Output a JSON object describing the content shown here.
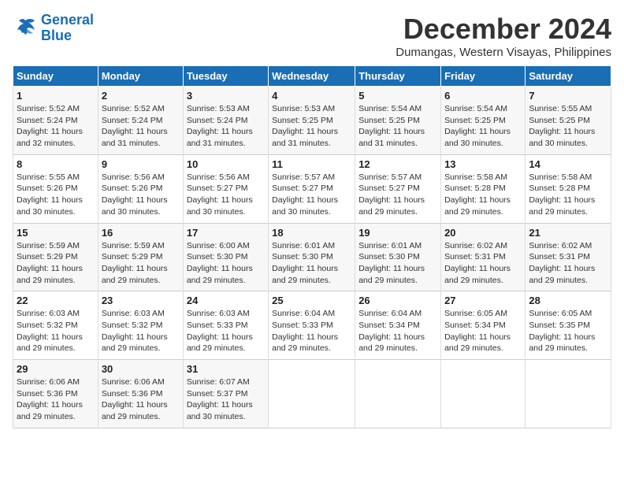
{
  "logo": {
    "line1": "General",
    "line2": "Blue"
  },
  "title": "December 2024",
  "location": "Dumangas, Western Visayas, Philippines",
  "header": {
    "days": [
      "Sunday",
      "Monday",
      "Tuesday",
      "Wednesday",
      "Thursday",
      "Friday",
      "Saturday"
    ]
  },
  "weeks": [
    [
      {
        "day": "1",
        "rise": "5:52 AM",
        "set": "5:24 PM",
        "daylight": "11 hours and 32 minutes."
      },
      {
        "day": "2",
        "rise": "5:52 AM",
        "set": "5:24 PM",
        "daylight": "11 hours and 31 minutes."
      },
      {
        "day": "3",
        "rise": "5:53 AM",
        "set": "5:24 PM",
        "daylight": "11 hours and 31 minutes."
      },
      {
        "day": "4",
        "rise": "5:53 AM",
        "set": "5:25 PM",
        "daylight": "11 hours and 31 minutes."
      },
      {
        "day": "5",
        "rise": "5:54 AM",
        "set": "5:25 PM",
        "daylight": "11 hours and 31 minutes."
      },
      {
        "day": "6",
        "rise": "5:54 AM",
        "set": "5:25 PM",
        "daylight": "11 hours and 30 minutes."
      },
      {
        "day": "7",
        "rise": "5:55 AM",
        "set": "5:25 PM",
        "daylight": "11 hours and 30 minutes."
      }
    ],
    [
      {
        "day": "8",
        "rise": "5:55 AM",
        "set": "5:26 PM",
        "daylight": "11 hours and 30 minutes."
      },
      {
        "day": "9",
        "rise": "5:56 AM",
        "set": "5:26 PM",
        "daylight": "11 hours and 30 minutes."
      },
      {
        "day": "10",
        "rise": "5:56 AM",
        "set": "5:27 PM",
        "daylight": "11 hours and 30 minutes."
      },
      {
        "day": "11",
        "rise": "5:57 AM",
        "set": "5:27 PM",
        "daylight": "11 hours and 30 minutes."
      },
      {
        "day": "12",
        "rise": "5:57 AM",
        "set": "5:27 PM",
        "daylight": "11 hours and 29 minutes."
      },
      {
        "day": "13",
        "rise": "5:58 AM",
        "set": "5:28 PM",
        "daylight": "11 hours and 29 minutes."
      },
      {
        "day": "14",
        "rise": "5:58 AM",
        "set": "5:28 PM",
        "daylight": "11 hours and 29 minutes."
      }
    ],
    [
      {
        "day": "15",
        "rise": "5:59 AM",
        "set": "5:29 PM",
        "daylight": "11 hours and 29 minutes."
      },
      {
        "day": "16",
        "rise": "5:59 AM",
        "set": "5:29 PM",
        "daylight": "11 hours and 29 minutes."
      },
      {
        "day": "17",
        "rise": "6:00 AM",
        "set": "5:30 PM",
        "daylight": "11 hours and 29 minutes."
      },
      {
        "day": "18",
        "rise": "6:01 AM",
        "set": "5:30 PM",
        "daylight": "11 hours and 29 minutes."
      },
      {
        "day": "19",
        "rise": "6:01 AM",
        "set": "5:30 PM",
        "daylight": "11 hours and 29 minutes."
      },
      {
        "day": "20",
        "rise": "6:02 AM",
        "set": "5:31 PM",
        "daylight": "11 hours and 29 minutes."
      },
      {
        "day": "21",
        "rise": "6:02 AM",
        "set": "5:31 PM",
        "daylight": "11 hours and 29 minutes."
      }
    ],
    [
      {
        "day": "22",
        "rise": "6:03 AM",
        "set": "5:32 PM",
        "daylight": "11 hours and 29 minutes."
      },
      {
        "day": "23",
        "rise": "6:03 AM",
        "set": "5:32 PM",
        "daylight": "11 hours and 29 minutes."
      },
      {
        "day": "24",
        "rise": "6:03 AM",
        "set": "5:33 PM",
        "daylight": "11 hours and 29 minutes."
      },
      {
        "day": "25",
        "rise": "6:04 AM",
        "set": "5:33 PM",
        "daylight": "11 hours and 29 minutes."
      },
      {
        "day": "26",
        "rise": "6:04 AM",
        "set": "5:34 PM",
        "daylight": "11 hours and 29 minutes."
      },
      {
        "day": "27",
        "rise": "6:05 AM",
        "set": "5:34 PM",
        "daylight": "11 hours and 29 minutes."
      },
      {
        "day": "28",
        "rise": "6:05 AM",
        "set": "5:35 PM",
        "daylight": "11 hours and 29 minutes."
      }
    ],
    [
      {
        "day": "29",
        "rise": "6:06 AM",
        "set": "5:36 PM",
        "daylight": "11 hours and 29 minutes."
      },
      {
        "day": "30",
        "rise": "6:06 AM",
        "set": "5:36 PM",
        "daylight": "11 hours and 29 minutes."
      },
      {
        "day": "31",
        "rise": "6:07 AM",
        "set": "5:37 PM",
        "daylight": "11 hours and 30 minutes."
      },
      null,
      null,
      null,
      null
    ]
  ]
}
